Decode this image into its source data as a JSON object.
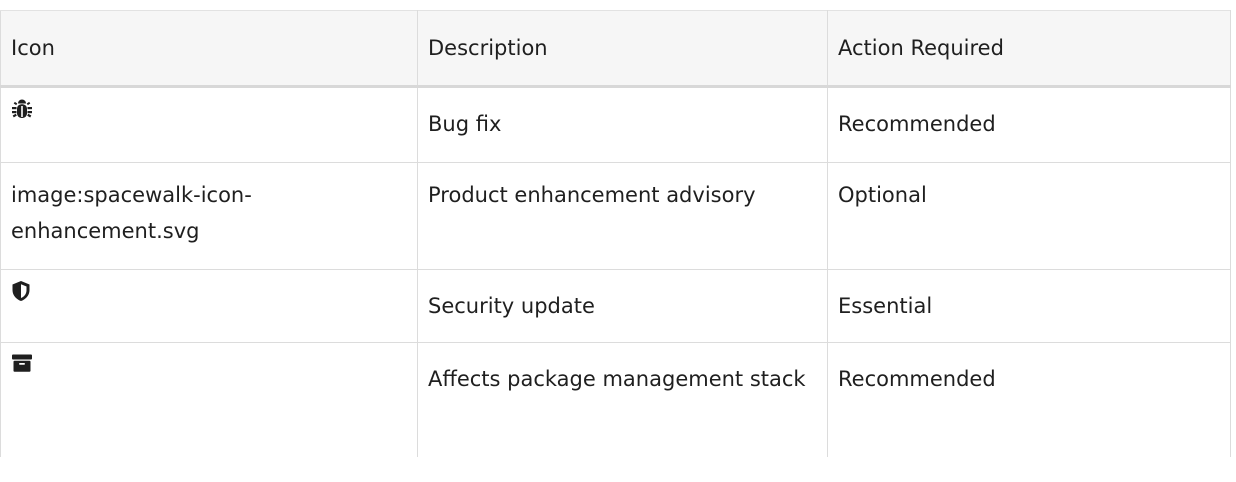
{
  "table": {
    "headers": [
      "Icon",
      "Description",
      "Action Required"
    ],
    "rows": [
      {
        "icon": "bug-icon",
        "icon_text": "",
        "description": "Bug fix",
        "action": "Recommended"
      },
      {
        "icon": "",
        "icon_text": "image:spacewalk-icon-enhancement.svg",
        "description": "Product enhancement advisory",
        "action": "Optional"
      },
      {
        "icon": "shield-icon",
        "icon_text": "",
        "description": "Security update",
        "action": "Essential"
      },
      {
        "icon": "archive-box-icon",
        "icon_text": "",
        "description": "Affects package management stack",
        "action": "Recommended"
      }
    ]
  },
  "colors": {
    "header_bg": "#f6f6f6",
    "border": "#dcdcdc",
    "text": "#1f1f1f"
  }
}
